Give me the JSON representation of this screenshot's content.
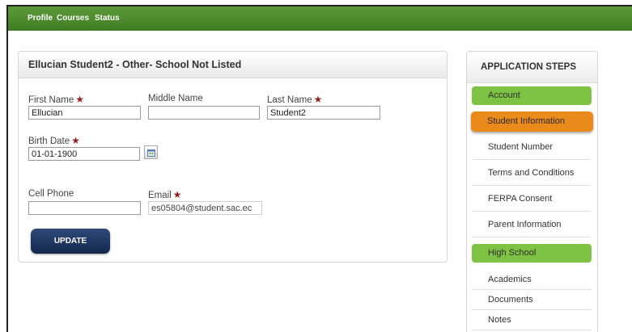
{
  "nav": {
    "items": [
      "Profile",
      "Courses",
      "Status"
    ]
  },
  "form": {
    "title": "Ellucian Student2 - Other- School Not Listed",
    "required_mark": "★",
    "first_name": {
      "label": "First Name",
      "value": "Ellucian"
    },
    "middle_name": {
      "label": "Middle Name",
      "value": ""
    },
    "last_name": {
      "label": "Last Name",
      "value": "Student2"
    },
    "birth_date": {
      "label": "Birth Date",
      "value": "01-01-1900"
    },
    "cell_phone": {
      "label": "Cell Phone",
      "value": ""
    },
    "email": {
      "label": "Email",
      "value": "es05804@student.sac.ec"
    },
    "update_label": "UPDATE"
  },
  "steps": {
    "title": "APPLICATION STEPS",
    "items": [
      {
        "label": "Account",
        "state": "section"
      },
      {
        "label": "Student Information",
        "state": "active"
      },
      {
        "label": "Student Number",
        "state": "step"
      },
      {
        "label": "Terms and Conditions",
        "state": "step"
      },
      {
        "label": "FERPA Consent",
        "state": "step"
      },
      {
        "label": "Parent Information",
        "state": "step"
      },
      {
        "label": "High School",
        "state": "section"
      },
      {
        "label": "Academics",
        "state": "step"
      },
      {
        "label": "Documents",
        "state": "step"
      },
      {
        "label": "Notes",
        "state": "step"
      }
    ]
  },
  "colors": {
    "nav_green": "#4a8a2c",
    "section_green": "#7dc242",
    "active_orange": "#ea8a1a",
    "required_red": "#9b1c1c",
    "button_navy": "#1f355f"
  }
}
